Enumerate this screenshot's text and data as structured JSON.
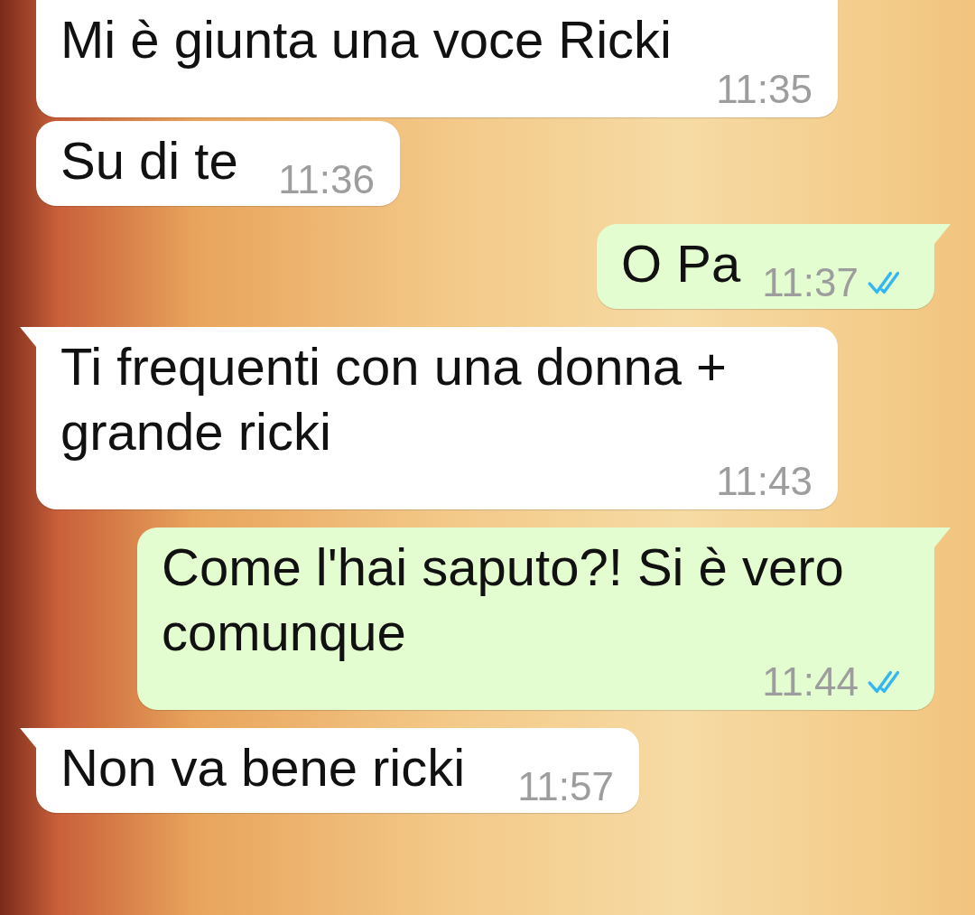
{
  "messages": [
    {
      "outgoing": false,
      "text": "Mi è giunta una voce Ricki",
      "time": "11:35",
      "tail": false
    },
    {
      "outgoing": false,
      "text": "Su di te",
      "time": "11:36",
      "tail": false
    },
    {
      "outgoing": true,
      "text": "O Pa",
      "time": "11:37",
      "tail": true,
      "read": true
    },
    {
      "outgoing": false,
      "text": "Ti frequenti con una donna + grande ricki",
      "time": "11:43",
      "tail": true
    },
    {
      "outgoing": true,
      "text": "Come l'hai saputo?! Si è vero comunque",
      "time": "11:44",
      "tail": true,
      "read": true
    },
    {
      "outgoing": false,
      "text": "Non va bene ricki",
      "time": "11:57",
      "tail": true
    }
  ]
}
